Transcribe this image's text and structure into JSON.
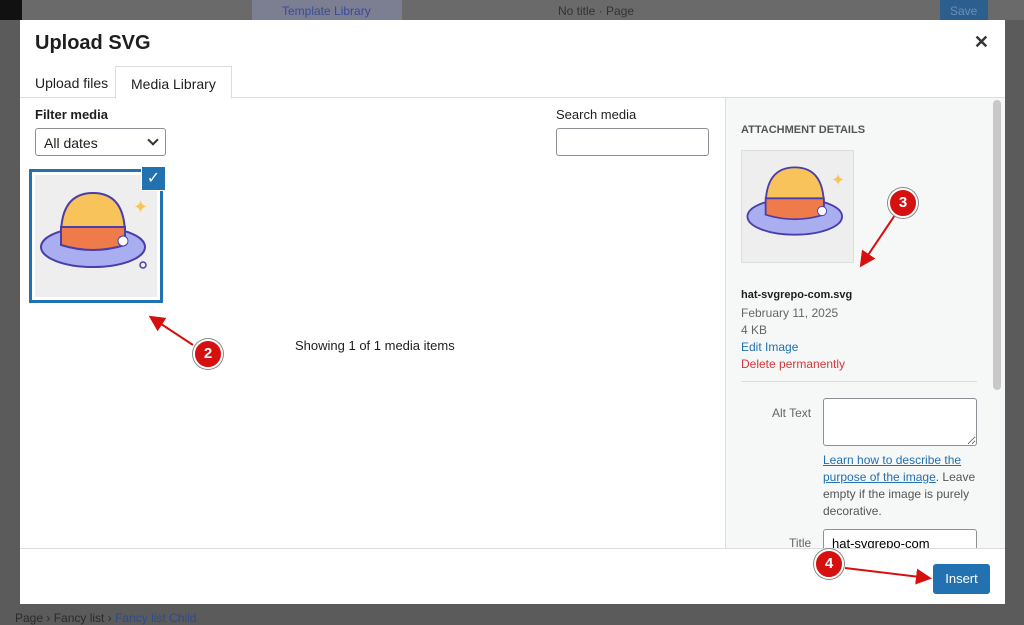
{
  "background": {
    "template_library": "Template Library",
    "page_title": "No title · Page",
    "save": "Save",
    "breadcrumb": [
      "Page",
      "Fancy list",
      "Fancy list Child"
    ]
  },
  "modal": {
    "title": "Upload SVG",
    "close_icon": "close-icon",
    "tabs": [
      {
        "label": "Upload files"
      },
      {
        "label": "Media Library",
        "active": true
      }
    ],
    "filter_label": "Filter media",
    "filter_value": "All dates",
    "search_label": "Search media",
    "search_value": "",
    "count_text": "Showing 1 of 1 media items",
    "details": {
      "heading": "ATTACHMENT DETAILS",
      "filename": "hat-svgrepo-com.svg",
      "date": "February 11, 2025",
      "size": "4 KB",
      "edit": "Edit Image",
      "delete": "Delete permanently",
      "alt_label": "Alt Text",
      "alt_value": "",
      "help_link": "Learn how to describe the purpose of the image",
      "help_text": ". Leave empty if the image is purely decorative.",
      "title_label": "Title",
      "title_value": "hat-svgrepo-com"
    },
    "insert": "Insert"
  },
  "annotations": [
    "2",
    "3",
    "4"
  ],
  "colors": {
    "accent": "#2271b1",
    "delete": "#d63638",
    "badge": "#d60f0f"
  }
}
